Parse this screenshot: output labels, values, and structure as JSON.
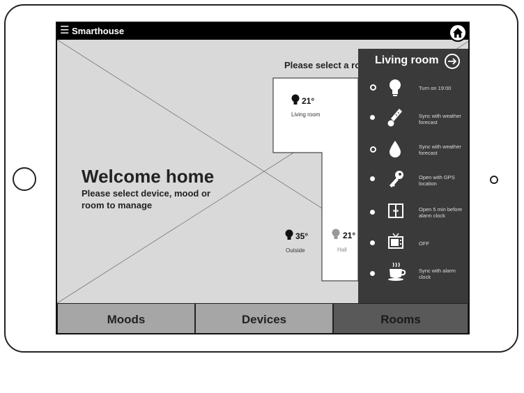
{
  "app": {
    "title": "Smarthouse"
  },
  "welcome": {
    "title": "Welcome home",
    "subtitle": "Please select device, mood or room to manage"
  },
  "floorplan": {
    "prompt": "Please select a room",
    "rooms": [
      {
        "label": "Living room",
        "temp": "21°"
      },
      {
        "label": "Outside",
        "temp": "35°"
      },
      {
        "label": "Hall",
        "temp": "21°"
      }
    ]
  },
  "panel": {
    "title": "Living room",
    "items": [
      {
        "icon": "light-bulb-icon",
        "text": "Turn on 19:00",
        "selected": false
      },
      {
        "icon": "thermometer-icon",
        "text": "Sync with weather forecast",
        "selected": true
      },
      {
        "icon": "water-drop-icon",
        "text": "Sync with weather forecast",
        "selected": false
      },
      {
        "icon": "key-icon",
        "text": "Open with GPS location",
        "selected": true
      },
      {
        "icon": "window-icon",
        "text": "Open 5 min before alarm clock",
        "selected": true
      },
      {
        "icon": "tv-icon",
        "text": "OFF",
        "selected": true
      },
      {
        "icon": "coffee-cup-icon",
        "text": "Sync with alarm clock",
        "selected": true
      }
    ]
  },
  "tabs": [
    {
      "label": "Moods",
      "active": false
    },
    {
      "label": "Devices",
      "active": false
    },
    {
      "label": "Rooms",
      "active": true
    }
  ],
  "colors": {
    "screen_bg": "#d9d9d9",
    "panel_bg": "#3a3a3a",
    "tab_bg": "#a6a6a6",
    "tab_active_bg": "#595959"
  }
}
